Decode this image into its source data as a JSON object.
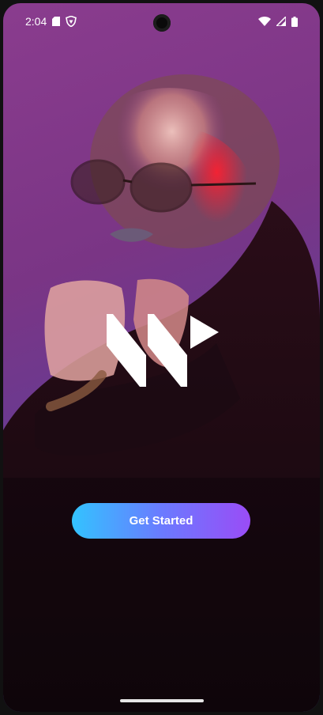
{
  "status_bar": {
    "time": "2:04",
    "left_icons": [
      "sd-card-icon",
      "shield-icon"
    ],
    "right_icons": [
      "wifi-icon",
      "signal-icon",
      "battery-icon"
    ]
  },
  "splash": {
    "logo": "app-logo",
    "cta_label": "Get Started"
  },
  "colors": {
    "background_top": "#8a3c8e",
    "background_bottom": "#4a5ab0",
    "cta_gradient_start": "#33c3ff",
    "cta_gradient_end": "#9a4cf6",
    "text": "#ffffff"
  }
}
